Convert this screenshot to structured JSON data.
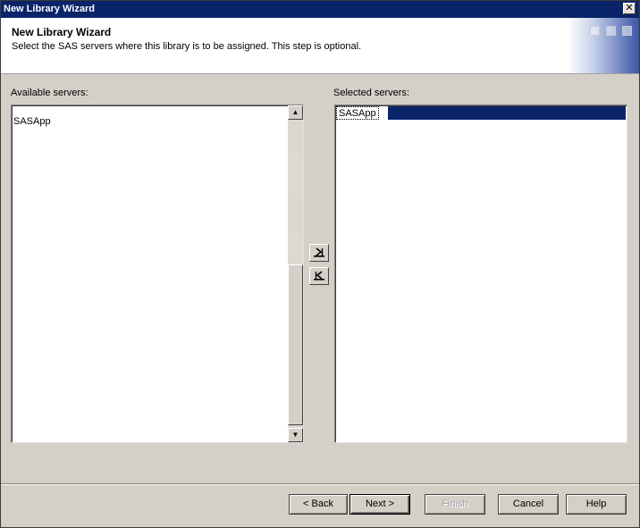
{
  "window": {
    "title": "New Library Wizard",
    "close_glyph": "✕"
  },
  "header": {
    "title": "New Library Wizard",
    "description": "Select the SAS servers where this library is to be assigned. This step is optional."
  },
  "available": {
    "label": "Available servers:",
    "items": [
      "SASApp"
    ]
  },
  "selected": {
    "label": "Selected servers:",
    "items": [
      "SASApp"
    ]
  },
  "transfer": {
    "add_icon": "move-right-icon",
    "remove_icon": "move-left-icon"
  },
  "buttons": {
    "back": "< Back",
    "next": "Next >",
    "finish": "Finish",
    "cancel": "Cancel",
    "help": "Help"
  },
  "colors": {
    "titlebar": "#0a246a",
    "selection": "#0a246a",
    "face": "#d4d0c8"
  }
}
